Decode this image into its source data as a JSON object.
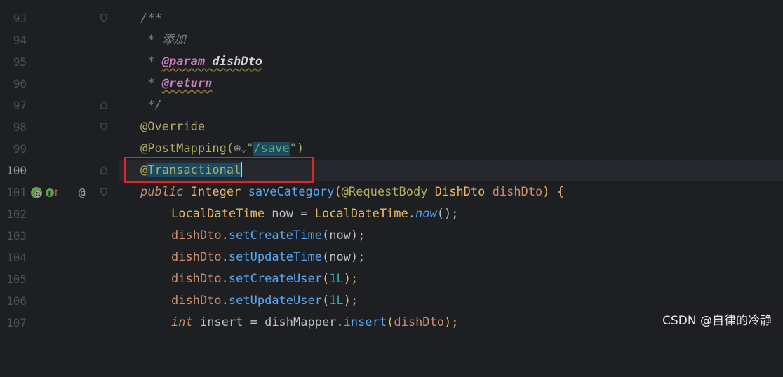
{
  "lines": [
    {
      "num": "93"
    },
    {
      "num": "94"
    },
    {
      "num": "95"
    },
    {
      "num": "96"
    },
    {
      "num": "97"
    },
    {
      "num": "98"
    },
    {
      "num": "99"
    },
    {
      "num": "100"
    },
    {
      "num": "101"
    },
    {
      "num": "102"
    },
    {
      "num": "103"
    },
    {
      "num": "104"
    },
    {
      "num": "105"
    },
    {
      "num": "106"
    },
    {
      "num": "107"
    }
  ],
  "code": {
    "l93": "/**",
    "l94_star": " * ",
    "l94_text": "添加",
    "l95_star": " * ",
    "l95_tag": "@param",
    "l95_space": " ",
    "l95_param": "dishDto",
    "l96_star": " * ",
    "l96_tag": "@return",
    "l97": " */",
    "l98": "@Override",
    "l99_anno": "@PostMapping(",
    "l99_globe": "⊕",
    "l99_chev": "⌄",
    "l99_q1": "\"",
    "l99_str": "/save",
    "l99_q2": "\"",
    "l99_close": ")",
    "l100_at": "@",
    "l100_name": "Transactional",
    "l101_public": "public",
    "l101_sp1": " ",
    "l101_type": "Integer",
    "l101_sp2": " ",
    "l101_fn": "saveCategory",
    "l101_paren": "(",
    "l101_anno": "@RequestBody",
    "l101_sp3": " ",
    "l101_ptype": "DishDto",
    "l101_sp4": " ",
    "l101_pname": "dishDto",
    "l101_end": ") {",
    "l102_type": "LocalDateTime",
    "l102_mid": " now = ",
    "l102_cls": "LocalDateTime",
    "l102_dot": ".",
    "l102_fn": "now",
    "l102_end": "();",
    "l103_obj": "dishDto",
    "l103_dot": ".",
    "l103_fn": "setCreateTime",
    "l103_args": "(now);",
    "l104_obj": "dishDto",
    "l104_dot": ".",
    "l104_fn": "setUpdateTime",
    "l104_args": "(now);",
    "l105_obj": "dishDto",
    "l105_dot": ".",
    "l105_fn": "setCreateUser",
    "l105_p1": "(",
    "l105_num": "1L",
    "l105_p2": ");",
    "l106_obj": "dishDto",
    "l106_dot": ".",
    "l106_fn": "setUpdateUser",
    "l106_p1": "(",
    "l106_num": "1L",
    "l106_p2": ");",
    "l107_int": "int",
    "l107_mid": " insert = ",
    "l107_obj": "dishMapper",
    "l107_dot": ".",
    "l107_fn": "insert",
    "l107_p1": "(",
    "l107_arg": "dishDto",
    "l107_p2": ");"
  },
  "gutter": {
    "at_icon": "@",
    "up_arrow": "↑"
  },
  "watermark": "CSDN @自律的冷静",
  "colors": {
    "background": "#1e1f22",
    "highlight_box": "#e0242a",
    "annotation": "#b3ae60",
    "keyword": "#cf8e6d",
    "function": "#56a8f5",
    "string": "#6aab73",
    "number": "#2aacb8",
    "field": "#c77dbb",
    "comment": "#7a7e85"
  }
}
